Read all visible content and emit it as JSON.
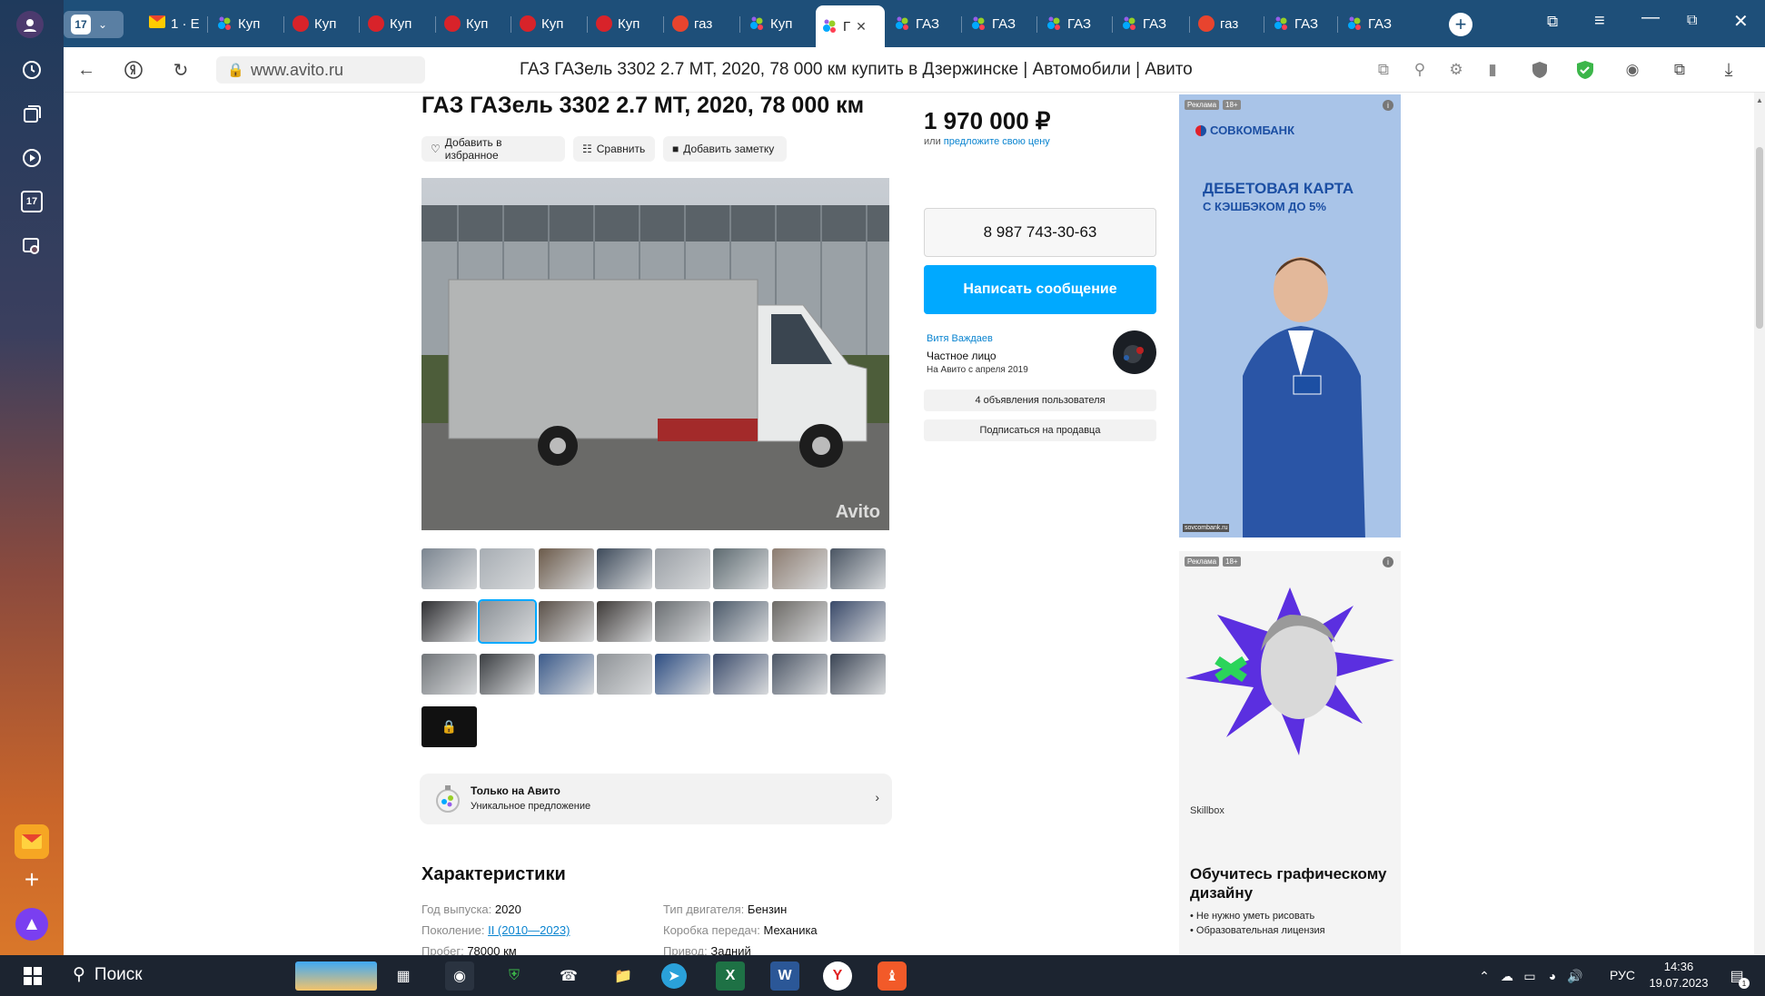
{
  "browser": {
    "tab_count_badge": "17",
    "tabs": [
      {
        "label": "1 · E",
        "icon": "mail-icon"
      },
      {
        "label": "Куп",
        "icon": "avito-icon"
      },
      {
        "label": "Куп",
        "icon": "drom-icon"
      },
      {
        "label": "Куп",
        "icon": "drom-icon"
      },
      {
        "label": "Куп",
        "icon": "drom-icon"
      },
      {
        "label": "Куп",
        "icon": "drom-icon"
      },
      {
        "label": "Куп",
        "icon": "drom-icon"
      },
      {
        "label": "газ",
        "icon": "yandex-icon"
      },
      {
        "label": "Куп",
        "icon": "avito-icon"
      },
      {
        "label": "Г",
        "icon": "avito-icon",
        "active": true
      },
      {
        "label": "ГАЗ",
        "icon": "avito-icon"
      },
      {
        "label": "ГАЗ",
        "icon": "avito-icon"
      },
      {
        "label": "ГАЗ",
        "icon": "avito-icon"
      },
      {
        "label": "ГАЗ",
        "icon": "avito-icon"
      },
      {
        "label": "газ",
        "icon": "yandex-icon"
      },
      {
        "label": "ГАЗ",
        "icon": "avito-icon"
      },
      {
        "label": "ГАЗ",
        "icon": "avito-icon"
      }
    ],
    "url": "www.avito.ru",
    "page_title": "ГАЗ ГАЗель 3302 2.7 MT, 2020, 78 000 км купить в Дзержинске | Автомобили | Авито",
    "sidebar_calendar": "17"
  },
  "listing": {
    "title": "ГАЗ ГАЗель 3302 2.7 MT, 2020, 78 000 км",
    "actions": {
      "favorite": "Добавить в избранное",
      "compare": "Сравнить",
      "note": "Добавить заметку"
    },
    "watermark": "Avito",
    "price": "1 970 000 ₽",
    "price_sub_prefix": "или",
    "price_sub_link": "предложите свою цену",
    "phone": "8 987 743-30-63",
    "message_button": "Написать сообщение",
    "seller": {
      "name": "Витя Важдаев",
      "type": "Частное лицо",
      "since": "На Авито с апреля 2019"
    },
    "user_ads_button": "4 объявления пользователя",
    "subscribe_button": "Подписаться на продавца",
    "avito_only": {
      "title": "Только на Авито",
      "subtitle": "Уникальное предложение"
    },
    "characteristics_title": "Характеристики",
    "specs_left": [
      {
        "k": "Год выпуска:",
        "v": "2020"
      },
      {
        "k": "Поколение:",
        "v": "II (2010—2023)",
        "link": true
      },
      {
        "k": "Пробег:",
        "v": "78000 км"
      }
    ],
    "specs_right": [
      {
        "k": "Тип двигателя:",
        "v": "Бензин"
      },
      {
        "k": "Коробка передач:",
        "v": "Механика"
      },
      {
        "k": "Привод:",
        "v": "Задний"
      }
    ]
  },
  "ads": {
    "tag": "Реклама",
    "age": "18+",
    "ad1": {
      "brand": "СОВКОМБАНК",
      "headline1": "ДЕБЕТОВАЯ КАРТА",
      "headline2": "С КЭШБЭКОМ ДО 5%",
      "domain": "sovcombank.ru"
    },
    "ad2": {
      "brand": "Skillbox",
      "headline": "Обучитесь графическому дизайну",
      "bullet1": "Не нужно уметь рисовать",
      "bullet2": "Образовательная лицензия"
    }
  },
  "taskbar": {
    "search_placeholder": "Поиск",
    "lang": "РУС",
    "time": "14:36",
    "date": "19.07.2023",
    "notification_count": "1"
  },
  "colors": {
    "tabbar": "#1e4f79",
    "accent": "#00a9ff",
    "link": "#0a84d0"
  }
}
